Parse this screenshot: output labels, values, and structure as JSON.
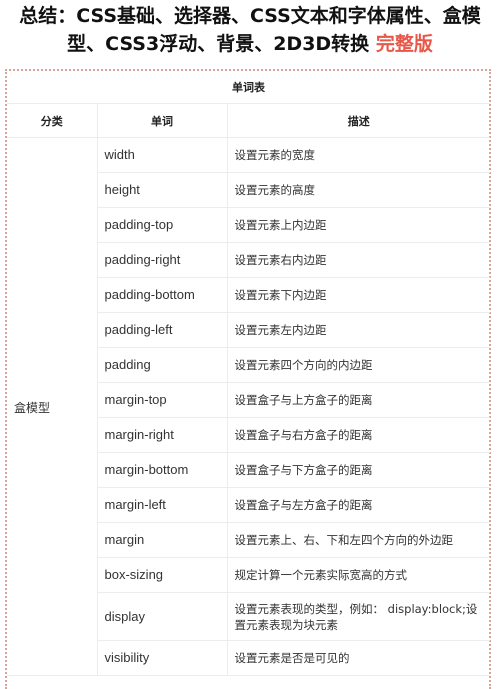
{
  "title": {
    "line1": "总结：CSS基础、选择器、CSS文本和字体属性、盒模",
    "line2_main": "型、CSS3浮动、背景、2D3D转换 ",
    "line2_accent": "完整版",
    "accent_color": "#e8584a"
  },
  "table": {
    "caption": "单词表",
    "headers": [
      "分类",
      "单词",
      "描述"
    ],
    "category": "盒模型",
    "rows": [
      {
        "word": "width",
        "desc": "设置元素的宽度"
      },
      {
        "word": "height",
        "desc": "设置元素的高度"
      },
      {
        "word": "padding-top",
        "desc": "设置元素上内边距"
      },
      {
        "word": "padding-right",
        "desc": "设置元素右内边距"
      },
      {
        "word": "padding-bottom",
        "desc": "设置元素下内边距"
      },
      {
        "word": "padding-left",
        "desc": "设置元素左内边距"
      },
      {
        "word": "padding",
        "desc": "设置元素四个方向的内边距"
      },
      {
        "word": "margin-top",
        "desc": "设置盒子与上方盒子的距离"
      },
      {
        "word": "margin-right",
        "desc": "设置盒子与右方盒子的距离"
      },
      {
        "word": "margin-bottom",
        "desc": "设置盒子与下方盒子的距离"
      },
      {
        "word": "margin-left",
        "desc": "设置盒子与左方盒子的距离"
      },
      {
        "word": "margin",
        "desc": "设置元素上、右、下和左四个方向的外边距"
      },
      {
        "word": "box-sizing",
        "desc": "规定计算一个元素实际宽高的方式"
      },
      {
        "word": "display",
        "desc": "设置元素表现的类型，例如： display:block;设置元素表现为块元素"
      },
      {
        "word": "visibility",
        "desc": "设置元素是否是可见的"
      }
    ]
  }
}
